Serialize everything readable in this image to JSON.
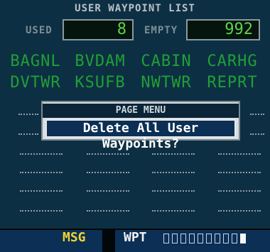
{
  "header": {
    "title": "USER WAYPOINT LIST"
  },
  "counts": {
    "used_label": "USED",
    "used_value": "8",
    "empty_label": "EMPTY",
    "empty_value": "992"
  },
  "waypoints": [
    [
      "BAGNL",
      "BVDAM",
      "CABIN",
      "CARHG"
    ],
    [
      "DVTWR",
      "KSUFB",
      "NWTWR",
      "REPRT"
    ]
  ],
  "empty_rows": 5,
  "page_menu": {
    "title": "PAGE MENU",
    "selected_option": "Delete All User Waypoints?"
  },
  "status_bar": {
    "msg_label": "MSG",
    "page_label": "WPT",
    "page_index": {
      "segments": 10,
      "current": 10
    }
  }
}
